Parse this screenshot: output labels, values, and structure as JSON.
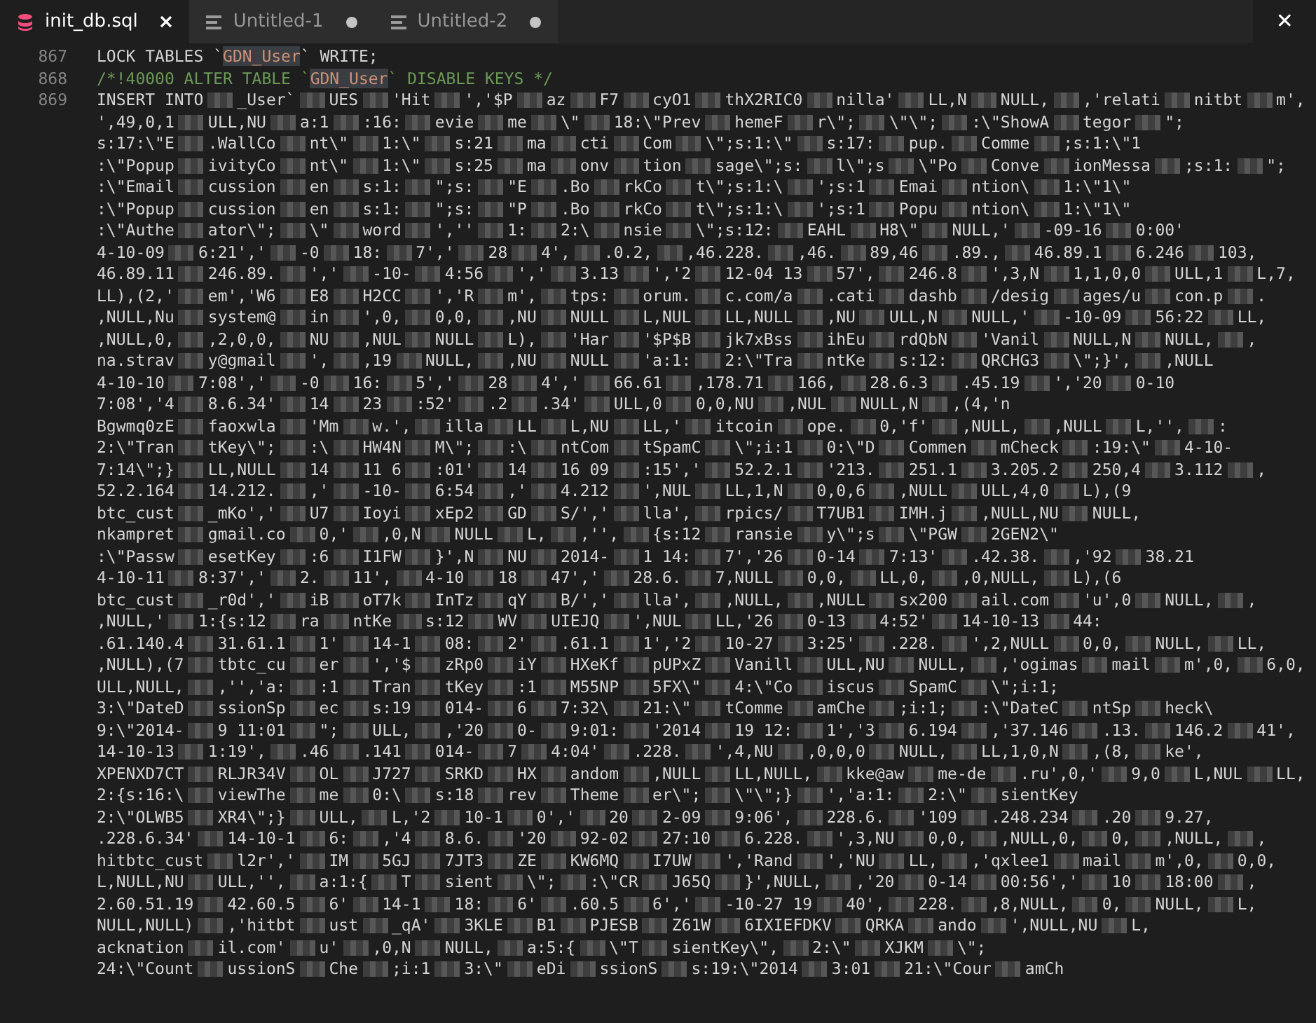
{
  "tabs": [
    {
      "label": "init_db.sql",
      "kind": "database",
      "selected": true,
      "modified": false
    },
    {
      "label": "Untitled-1",
      "kind": "text",
      "selected": false,
      "modified": true
    },
    {
      "label": "Untitled-2",
      "kind": "text",
      "selected": false,
      "modified": true
    }
  ],
  "close_label": "✕",
  "lines": [
    {
      "number": "867",
      "parts": [
        {
          "kind": "plain",
          "text": "LOCK TABLES `"
        },
        {
          "kind": "highlight",
          "text": "GDN_User"
        },
        {
          "kind": "plain",
          "text": "` WRITE;"
        }
      ]
    },
    {
      "number": "868",
      "parts": [
        {
          "kind": "comment",
          "text": "/*!40000 ALTER TABLE `"
        },
        {
          "kind": "highlight",
          "text": "GDN_User"
        },
        {
          "kind": "comment",
          "text": "` DISABLE KEYS */"
        }
      ]
    }
  ],
  "insert_line": {
    "number": "869",
    "rows": [
      [
        "INSERT INTO",
        "_User`",
        "UES",
        "'Hit",
        "','$P",
        "az",
        "F7",
        "cyO1",
        "thX2RIC0",
        "nilla'",
        "LL,N",
        "NULL,",
        ",'relati",
        "nitbt",
        "m',"
      ],
      [
        "',49,0,1",
        "ULL,NU",
        "a:1",
        ":16:",
        "evie",
        "me",
        "\\\"",
        "18:\\\"Prev",
        "hemeF",
        "r\\\";",
        "\\\"\\\";",
        ":\\\"ShowA",
        "tegor",
        "\";"
      ],
      [
        "s:17:\\\"E",
        ".WallCo",
        "nt\\\"",
        "1:\\\"",
        "s:21",
        "ma",
        "cti",
        "Com",
        "\\\";s:1:\\\"",
        "s:17:",
        "pup.",
        "Comme",
        ";s:1:\\\"1"
      ],
      [
        ":\\\"Popup",
        "ivityCo",
        "nt\\\"",
        "1:\\\"",
        "s:25",
        "ma",
        "onv",
        "tion",
        "sage\\\";s:",
        "l\\\";s",
        "\\\"Po",
        "Conve",
        "ionMessa",
        ";s:1:",
        "\";"
      ],
      [
        ":\\\"Email",
        "cussion",
        "en",
        "s:1:",
        "\";s:",
        "\"E",
        ".Bo",
        "rkCo",
        "t\\\";s:1:\\",
        "';s:1",
        "Emai",
        "ntion\\",
        "1:\\\"1\\\""
      ],
      [
        ":\\\"Popup",
        "cussion",
        "en",
        "s:1:",
        "\";s:",
        "\"P",
        ".Bo",
        "rkCo",
        "t\\\";s:1:\\",
        "';s:1",
        "Popu",
        "ntion\\",
        "1:\\\"1\\\""
      ],
      [
        ":\\\"Authe",
        "ator\\\";",
        "\\\"",
        "word",
        "',''",
        "1:",
        "2:\\",
        "nsie",
        "\\\";s:12:",
        "EAHL",
        "H8\\\"",
        "NULL,'",
        "-09-16",
        "0:00'"
      ],
      [
        "4-10-09",
        "6:21','",
        "-0",
        "18:",
        "7','",
        "28",
        "4',",
        ".0.2,",
        ",46.228.",
        ",46.",
        "89,46",
        ".89.,",
        "46.89.1",
        "6.246",
        "103,"
      ],
      [
        "46.89.11",
        "246.89.",
        "','",
        "-10-",
        "4:56",
        "','",
        "3.13",
        "','2",
        "12-04 13",
        "57',",
        "246.8",
        "',3,N",
        "1,1,0,0",
        "ULL,1",
        "L,7,"
      ],
      [
        "LL),(2,'",
        "em','W6",
        "E8",
        "H2CC",
        "','R",
        "m',",
        "tps:",
        "orum.",
        "c.com/a",
        ".cati",
        "dashb",
        "/desig",
        "ages/u",
        "con.p",
        "."
      ],
      [
        ",NULL,Nu",
        "system@",
        "in",
        "',0,",
        "0,0,",
        ",NU",
        "NULL",
        "L,NUL",
        "LL,NULL",
        ",NU",
        "ULL,N",
        "NULL,'",
        "-10-09",
        "56:22",
        "LL,"
      ],
      [
        ",NULL,0,",
        ",2,0,0,",
        "NU",
        ",NUL",
        "NULL",
        "L),",
        "'Har",
        "'$P$B",
        "jk7xBss",
        "ihEu",
        "rdQbN",
        "'Vanil",
        "NULL,N",
        "NULL,",
        ","
      ],
      [
        "na.strav",
        "y@gmail",
        "',",
        ",19",
        "NULL,",
        ",NU",
        "NULL",
        "'a:1:",
        "2:\\\"Tra",
        "ntKe",
        "s:12:",
        "QRCHG3",
        "\\\";}',",
        ",NULL"
      ],
      [
        "4-10-10",
        "7:08','",
        "-0",
        "16:",
        "5','",
        "28",
        "4','",
        "66.61",
        ",178.71",
        "166,",
        "28.6.3",
        ".45.19",
        "','20",
        "0-10"
      ],
      [
        "7:08','4",
        "8.6.34'",
        "14",
        "23",
        ":52'",
        ".2",
        ".34'",
        "ULL,0",
        "0,0,NU",
        ",NUL",
        "NULL,N",
        ",(4,'n"
      ],
      [
        "Bgwmq0zE",
        "faoxwla",
        "'Mm",
        "w.',",
        "illa",
        "LL",
        "L,NU",
        "LL,'",
        "itcoin",
        "ope.",
        "0,'f'",
        ",NULL,",
        ",NULL",
        "L,'',",
        ":"
      ],
      [
        "2:\\\"Tran",
        "tKey\\\";",
        ":\\",
        "HW4N",
        "M\\\";",
        ":\\",
        "ntCom",
        "tSpamC",
        "\\\";i:1",
        "0:\\\"D",
        "Commen",
        "mCheck",
        ":19:\\\"",
        "4-10-"
      ],
      [
        "7:14\\\";}",
        "LL,NULL",
        "14",
        "11 6",
        ":01'",
        "14",
        "16 09",
        ":15','",
        "52.2.1",
        "'213.",
        "251.1",
        "3.205.2",
        "250,4",
        "3.112",
        ","
      ],
      [
        "52.2.164",
        "14.212.",
        ",'",
        "-10-",
        "6:54",
        ",'",
        "4.212",
        "',NUL",
        "LL,1,N",
        "0,0,6",
        ",NULL",
        "ULL,4,0",
        "L),(9"
      ],
      [
        "btc_cust",
        "_mKo','",
        "U7",
        "Ioyi",
        "xEp2",
        "GD",
        "S/','",
        "lla',",
        "rpics/",
        "T7UB1",
        "IMH.j",
        ",NULL,NU",
        "NULL,"
      ],
      [
        "nkampret",
        "gmail.co",
        "0,'",
        ",0,N",
        "NULL",
        "L,",
        ",'',",
        "{s:12",
        "ransie",
        "y\\\";s",
        "\\\"PGW",
        "2GEN2\\\""
      ],
      [
        ":\\\"Passw",
        "esetKey",
        ":6",
        "I1FW",
        "}',N",
        "NU",
        "2014-",
        "1 14:",
        "7','26",
        "0-14",
        "7:13'",
        ".42.38.",
        ",'92",
        "38.21"
      ],
      [
        "4-10-11",
        "8:37','",
        "2.",
        "11',",
        "4-10",
        "18",
        "47','",
        "28.6.",
        "7,NULL",
        "0,0,",
        "LL,0,",
        ",0,NULL,",
        "L),(6"
      ],
      [
        "btc_cust",
        "_r0d','",
        "iB",
        "oT7k",
        "InTz",
        "qY",
        "B/','",
        "lla',",
        ",NULL,",
        ",NULL",
        "sx200",
        "ail.com",
        "'u',0",
        "NULL,",
        ","
      ],
      [
        ",NULL,'",
        "1:{s:12",
        "ra",
        "ntKe",
        "s:12",
        "WV",
        "UIEJQ",
        "',NUL",
        "LL,'26",
        "0-13",
        "4:52'",
        "14-10-13",
        "44:"
      ],
      [
        ".61.140.4",
        "31.61.1",
        "1'",
        "14-1",
        "08:",
        "2'",
        ".61.1",
        "1','2",
        "10-27",
        "3:25'",
        ".228.",
        "',2,NULL",
        "0,0,",
        "NULL,",
        "LL,"
      ],
      [
        ",NULL),(7",
        "tbtc_cu",
        "er",
        "','$",
        "zRp0",
        "iY",
        "HXeKf",
        "pUPxZ",
        "Vanill",
        "ULL,NU",
        "NULL,",
        ",'ogimas",
        "mail",
        "m',0,",
        "6,0,"
      ],
      [
        "ULL,NULL,",
        ",'','a:",
        ":1",
        "Tran",
        "tKey",
        ":1",
        "M55NP",
        "5FX\\\"",
        "4:\\\"Co",
        "iscus",
        "SpamC",
        "\\\";i:1;"
      ],
      [
        "3:\\\"DateD",
        "ssionSp",
        "ec",
        "s:19",
        "014-",
        "6",
        "7:32\\",
        "21:\\\"",
        "tComme",
        "amChe",
        ";i:1;",
        ":\\\"DateC",
        "ntSp",
        "heck\\"
      ],
      [
        "9:\\\"2014-",
        "9 11:01",
        "\";",
        "ULL,",
        ",'20",
        "0-",
        "9:01:",
        "'2014",
        "19 12:",
        "1','3",
        "6.194",
        ",'37.146",
        ".13.",
        "146.2",
        "41',"
      ],
      [
        "14-10-13",
        "1:19',",
        ".46",
        ".141",
        "014-",
        "7",
        "4:04'",
        ".228.",
        "',4,NU",
        ",0,0,0",
        "NULL,",
        "LL,1,0,N",
        ",(8,",
        "ke',"
      ],
      [
        "XPENXD7CT",
        "RLJR34V",
        "OL",
        "J727",
        "SRKD",
        "HX",
        "andom",
        ",NULL",
        "LL,NULL,",
        "kke@aw",
        "me-de",
        ".ru',0,'",
        "9,0",
        "L,NUL",
        "LL,"
      ],
      [
        "2:{s:16:\\",
        "viewThe",
        "me",
        "0:\\",
        "s:18",
        "rev",
        "Theme",
        "er\\\";",
        "\\\"\\\";}",
        "','a:1:",
        "2:\\\"",
        "sientKey"
      ],
      [
        "2:\\\"OLWB5",
        "XR4\\\";}",
        "ULL,",
        "L,'2",
        "10-1",
        "0','",
        "20",
        "2-09",
        "9:06',",
        "228.6.",
        "'109",
        ".248.234",
        ".20",
        "9.27,"
      ],
      [
        ".228.6.34'",
        "14-10-1",
        "6:",
        ",'4",
        "8.6.",
        "'20",
        "92-02",
        "27:10",
        "6.228.",
        "',3,NU",
        "0,0,",
        ",NULL,0,",
        "0,",
        ",NULL,",
        ","
      ],
      [
        "hitbtc_cust",
        "l2r','",
        "IM",
        "5GJ",
        "7JT3",
        "ZE",
        "KW6MQ",
        "I7UW",
        "','Rand",
        "','NU",
        "LL,",
        ",'qxlee1",
        "mail",
        "m',0,",
        "0,0,"
      ],
      [
        "L,NULL,NU",
        "ULL,'',",
        "a:1:{",
        "T",
        "sient",
        "\\\";",
        ":\\\"CR",
        "J65Q",
        "}',NULL,",
        ",'20",
        "0-14",
        "00:56','",
        "10",
        "18:00",
        ","
      ],
      [
        "2.60.51.19",
        "42.60.5",
        "6'",
        "14-1",
        "18:",
        "6'",
        ".60.5",
        "6','",
        "-10-27 19",
        "40',",
        "228.",
        ",8,NULL,",
        "0,",
        "NULL,",
        "L,"
      ],
      [
        "NULL,NULL)",
        ",'hitbt",
        "ust",
        "_qA'",
        "3KLE",
        "B1",
        "PJESB",
        "Z61W",
        "6IXIEFDKV",
        "QRKA",
        "ando",
        "',NULL,NU",
        "L,"
      ],
      [
        "acknation",
        "il.com'",
        "u'",
        ",0,N",
        "NULL,",
        "a:5:{",
        "\\\"T",
        "sientKey\\\",",
        "2:\\\"",
        "XJKM",
        "\\\";"
      ],
      [
        "24:\\\"Count",
        "ussionS",
        "Che",
        ";i:1",
        "3:\\\"",
        "eDi",
        "ssionS",
        "s:19:\\\"2014",
        "3:01",
        "21:\\\"Cour",
        "amCh"
      ]
    ]
  }
}
